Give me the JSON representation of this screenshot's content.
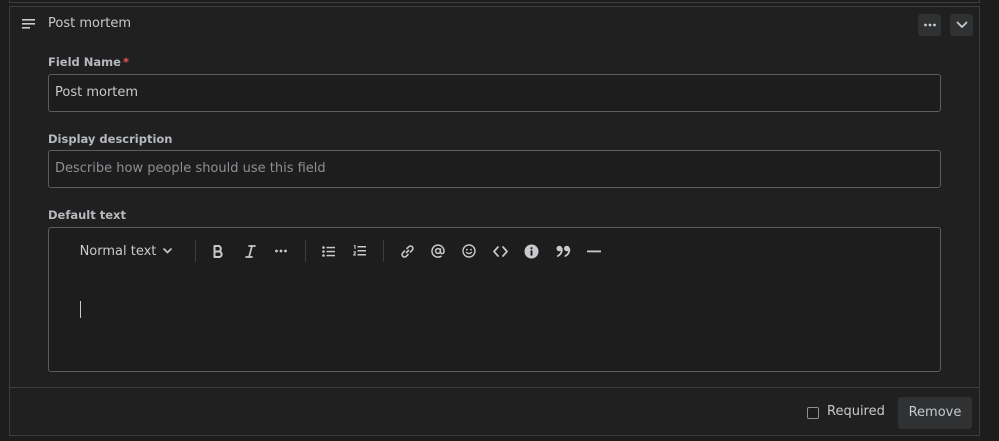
{
  "header": {
    "title": "Post mortem",
    "icons": [
      "lines-icon",
      "more-icon",
      "chevron-down-icon"
    ]
  },
  "field_name": {
    "label": "Field Name",
    "required_marker": "*",
    "value": "Post mortem"
  },
  "display_description": {
    "label": "Display description",
    "placeholder": "Describe how people should use this field"
  },
  "default_text": {
    "label": "Default text",
    "toolbar": {
      "text_style": "Normal text",
      "icons": [
        "bold-icon",
        "italic-icon",
        "more-formatting-icon",
        "bullet-list-icon",
        "numbered-list-icon",
        "link-icon",
        "mention-icon",
        "emoji-icon",
        "code-icon",
        "info-icon",
        "quote-icon",
        "divider-icon"
      ]
    },
    "value": ""
  },
  "footer": {
    "required_label": "Required",
    "required_checked": false,
    "remove_label": "Remove"
  },
  "colors": {
    "background": "#1d1d1d",
    "border": "#3b3d40",
    "required_marker": "#e8574e",
    "button": "#2f3133"
  }
}
